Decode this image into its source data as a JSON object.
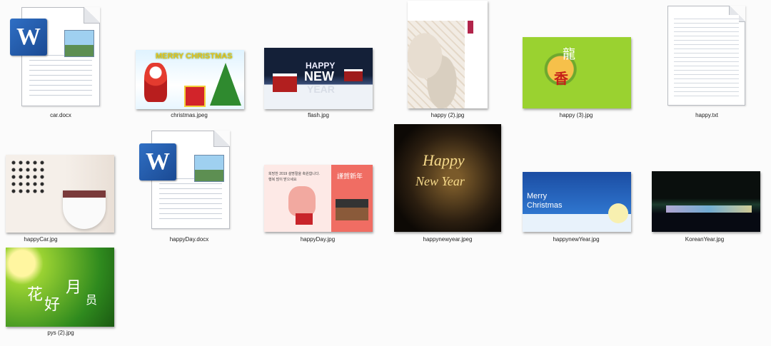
{
  "files": {
    "car_docx": "car.docx",
    "christmas_jpeg": "christmas.jpeg",
    "flash_jpg": "flash.jpg",
    "happy2_jpg": "happy (2).jpg",
    "happy3_jpg": "happy (3).jpg",
    "happy_txt": "happy.txt",
    "happycar_jpg": "happyCar.jpg",
    "happyday_docx": "happyDay.docx",
    "happyday_jpg": "happyDay.jpg",
    "happynewyear_jpeg": "happynewyear.jpeg",
    "happynewyear_jpg": "happynewYear.jpg",
    "koreanyear_jpg": "KoreanYear.jpg",
    "pys2_jpg": "pys (2).jpg"
  },
  "thumb_text": {
    "christmas_banner": "MERRY CHRISTMAS",
    "flash_happy": "HAPPY",
    "flash_new": "NEW",
    "flash_year": "YEAR",
    "happy3_char1": "香",
    "happy3_char2": "龍",
    "happynewyear_happy": "Happy",
    "happynewyear_new": "New Year",
    "happynewyear_jpg_merry": "Merry",
    "happynewyear_jpg_christmas": "Christmas",
    "happyday_korean1": "희망찬 2019 설명절을 축원합니다.",
    "happyday_korean2": "행복 많이 받으세요",
    "happyday_chinese": "謹賀新年",
    "pys_char1": "花",
    "pys_char2": "好",
    "pys_char3": "月",
    "pys_char4": "员"
  },
  "icons": {
    "word": "W"
  }
}
